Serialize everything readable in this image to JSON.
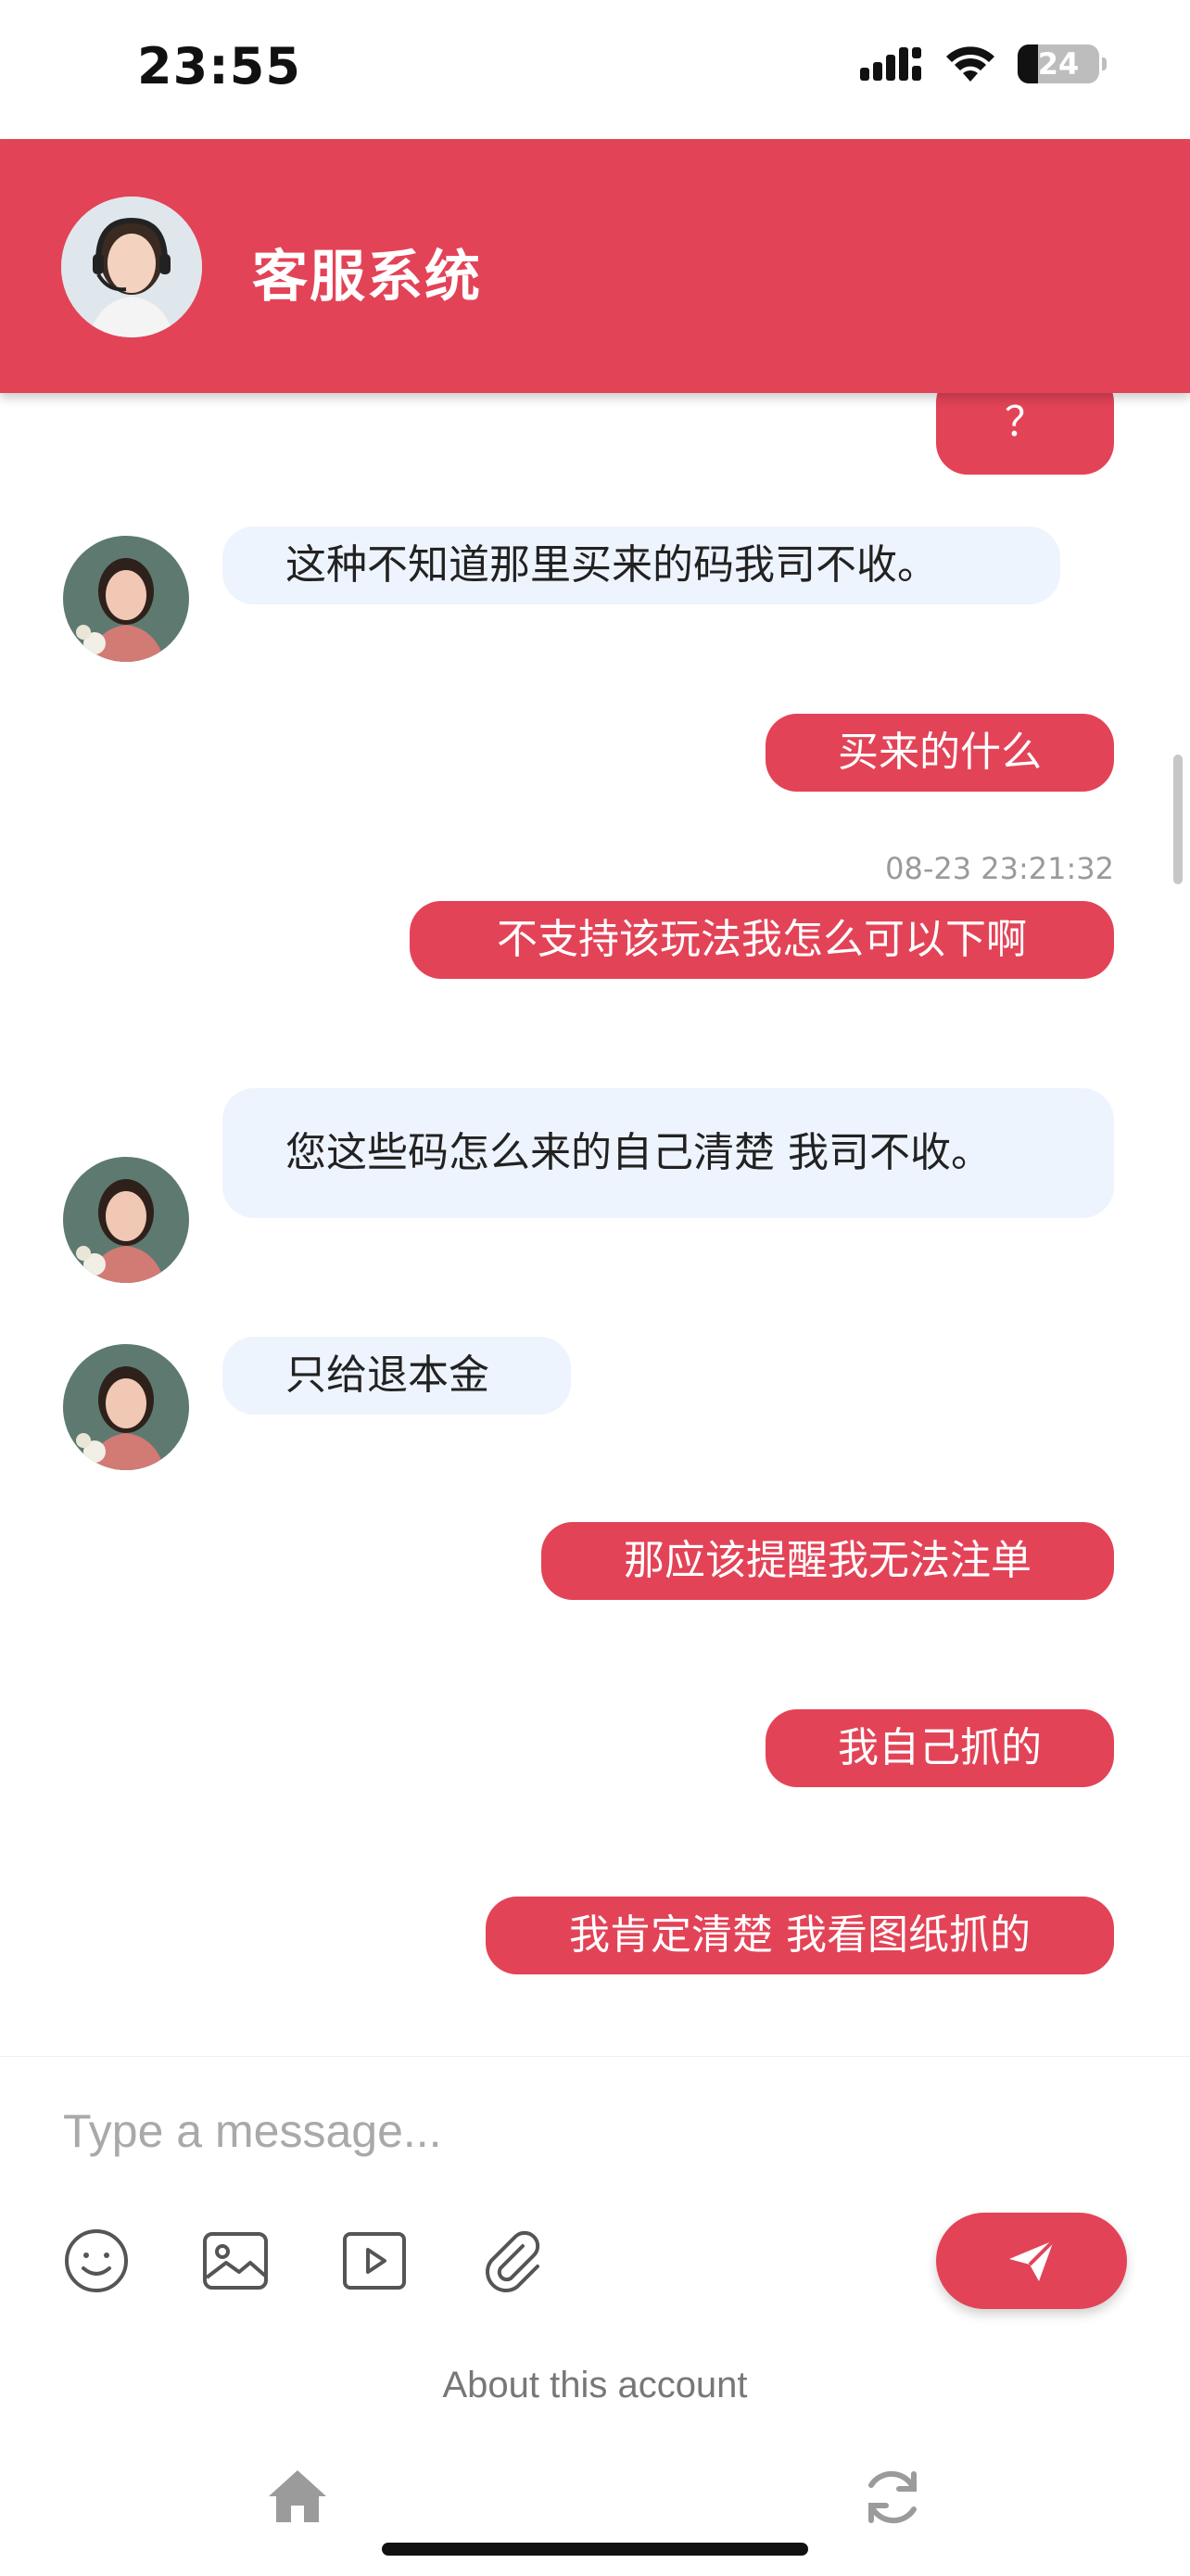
{
  "status_bar": {
    "time": "23:55",
    "battery": "24"
  },
  "header": {
    "title": "客服系统"
  },
  "messages": [
    {
      "dir": "out",
      "text": "？"
    },
    {
      "dir": "in",
      "text": "这种不知道那里买来的码我司不收。"
    },
    {
      "dir": "out",
      "text": "买来的什么",
      "time": "08-23 23:21:32"
    },
    {
      "dir": "out",
      "text": "不支持该玩法我怎么可以下啊"
    },
    {
      "dir": "in",
      "text": "您这些码怎么来的自己清楚  我司不收。"
    },
    {
      "dir": "in",
      "text": "只给退本金"
    },
    {
      "dir": "out",
      "text": "那应该提醒我无法注单"
    },
    {
      "dir": "out",
      "text": "我自己抓的"
    },
    {
      "dir": "out",
      "text": "我肯定清楚 我看图纸抓的"
    }
  ],
  "composer": {
    "placeholder": "Type a message...",
    "tools": [
      "emoji-icon",
      "image-icon",
      "video-icon",
      "attachment-icon"
    ],
    "send_icon": "send-icon"
  },
  "footer": {
    "about": "About this account",
    "nav": [
      "home-icon",
      "refresh-icon"
    ]
  },
  "colors": {
    "accent": "#e34357",
    "incoming_bubble": "#eef4fd"
  }
}
